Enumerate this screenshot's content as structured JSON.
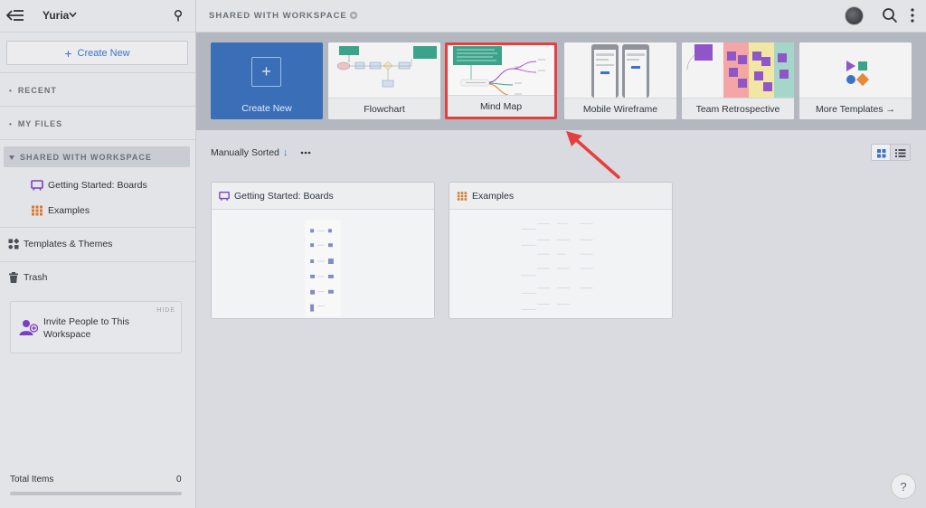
{
  "sidebar": {
    "workspace_name": "Yuria",
    "create_label": "Create New",
    "sections": {
      "recent": "RECENT",
      "my_files": "MY FILES",
      "shared": "SHARED WITH WORKSPACE"
    },
    "shared_items": [
      {
        "label": "Getting Started: Boards",
        "icon": "board-icon"
      },
      {
        "label": "Examples",
        "icon": "grid-doc-icon"
      }
    ],
    "templates_label": "Templates & Themes",
    "trash_label": "Trash",
    "invite": {
      "hide": "HIDE",
      "text": "Invite People to This Workspace"
    },
    "total_items_label": "Total Items",
    "total_items_count": "0"
  },
  "header": {
    "title": "SHARED WITH WORKSPACE"
  },
  "templates": [
    {
      "label": "Create New"
    },
    {
      "label": "Flowchart"
    },
    {
      "label": "Mind Map",
      "highlighted": true
    },
    {
      "label": "Mobile Wireframe"
    },
    {
      "label": "Team Retrospective"
    },
    {
      "label": "More Templates →"
    }
  ],
  "toolbar": {
    "sort_label": "Manually Sorted",
    "sort_arrow": "↓"
  },
  "documents": [
    {
      "title": "Getting Started: Boards",
      "icon": "board-icon"
    },
    {
      "title": "Examples",
      "icon": "grid-doc-icon"
    }
  ],
  "help_label": "?",
  "colors": {
    "accent": "#3d72c8",
    "create_tile": "#3a6fb8",
    "highlight": "#e53f3f",
    "board_icon": "#7b3fc4",
    "examples_icon": "#d9772b"
  }
}
